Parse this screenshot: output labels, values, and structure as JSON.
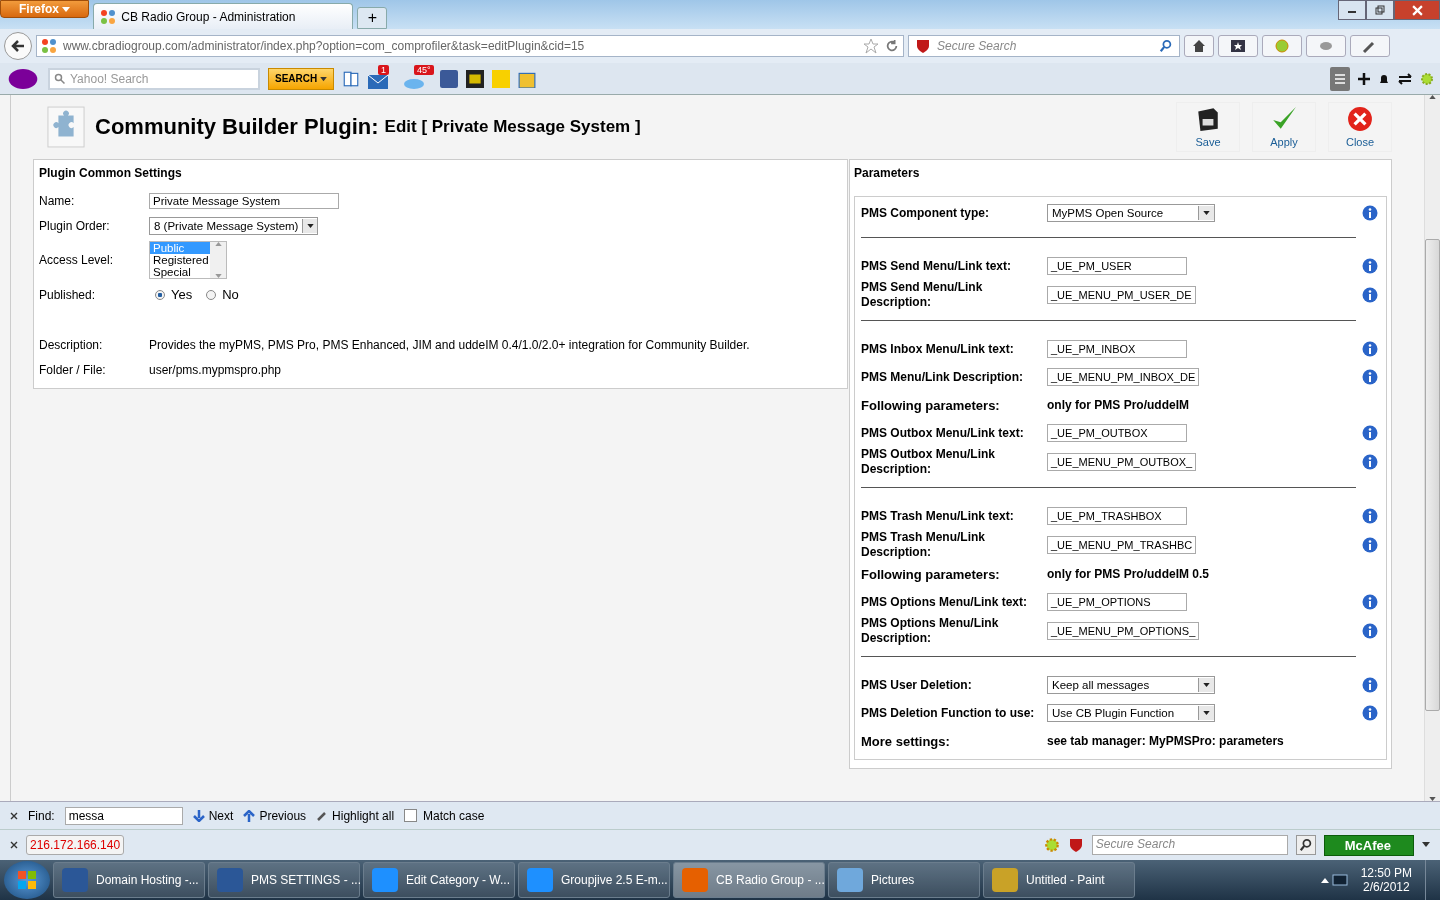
{
  "browser": {
    "menu_button": "Firefox",
    "tabs": [
      {
        "title": "CB Radio Group - Administration",
        "selected": true
      }
    ],
    "new_tab": "+",
    "url": "www.cbradiogroup.com/administrator/index.php?option=com_comprofiler&task=editPlugin&cid=15",
    "search_placeholder": "Secure Search"
  },
  "yahoo_toolbar": {
    "search_placeholder": "Yahoo! Search",
    "search_button": "SEARCH",
    "mail_badge": "1",
    "weather_badge": "45°"
  },
  "page": {
    "title": "Community Builder Plugin:",
    "subtitle": "Edit [ Private Message System ]",
    "actions": [
      {
        "kind": "save",
        "label": "Save"
      },
      {
        "kind": "apply",
        "label": "Apply"
      },
      {
        "kind": "close",
        "label": "Close"
      }
    ]
  },
  "common_settings": {
    "heading": "Plugin Common Settings",
    "name": {
      "label": "Name:",
      "value": "Private Message System"
    },
    "order": {
      "label": "Plugin Order:",
      "value": "8 (Private Message System)"
    },
    "access": {
      "label": "Access Level:",
      "options": [
        {
          "label": "Public",
          "selected": true
        },
        {
          "label": "Registered",
          "selected": false
        },
        {
          "label": "Special",
          "selected": false
        }
      ]
    },
    "published": {
      "label": "Published:",
      "options": [
        {
          "label": "Yes",
          "selected": true
        },
        {
          "label": "No",
          "selected": false
        }
      ]
    },
    "description": {
      "label": "Description:",
      "value": "Provides the myPMS, PMS Pro, PMS Enhanced, JIM and uddeIM 0.4/1.0/2.0+ integration for Community Builder."
    },
    "folder": {
      "label": "Folder / File:",
      "value": "user/pms.mypmspro.php"
    }
  },
  "parameters": {
    "heading": "Parameters",
    "groups": [
      [
        {
          "kind": "select",
          "label": "PMS Component type:",
          "value": "MyPMS Open Source"
        }
      ],
      [
        {
          "kind": "text",
          "label": "PMS Send Menu/Link text:",
          "value": "_UE_PM_USER"
        },
        {
          "kind": "text",
          "label": "PMS Send Menu/Link Description:",
          "value": "_UE_MENU_PM_USER_DE"
        }
      ],
      [
        {
          "kind": "text",
          "label": "PMS Inbox Menu/Link text:",
          "value": "_UE_PM_INBOX"
        },
        {
          "kind": "text",
          "label": "PMS Menu/Link Description:",
          "value": "_UE_MENU_PM_INBOX_DE"
        },
        {
          "kind": "note",
          "label": "Following parameters:",
          "value": "only for PMS Pro/uddeIM"
        },
        {
          "kind": "text",
          "label": "PMS Outbox Menu/Link text:",
          "value": "_UE_PM_OUTBOX"
        },
        {
          "kind": "text",
          "label": "PMS Outbox Menu/Link Description:",
          "value": "_UE_MENU_PM_OUTBOX_"
        }
      ],
      [
        {
          "kind": "text",
          "label": "PMS Trash Menu/Link text:",
          "value": "_UE_PM_TRASHBOX"
        },
        {
          "kind": "text",
          "label": "PMS Trash Menu/Link Description:",
          "value": "_UE_MENU_PM_TRASHBC"
        },
        {
          "kind": "note",
          "label": "Following parameters:",
          "value": "only for PMS Pro/uddeIM 0.5"
        },
        {
          "kind": "text",
          "label": "PMS Options Menu/Link text:",
          "value": "_UE_PM_OPTIONS"
        },
        {
          "kind": "text",
          "label": "PMS Options Menu/Link Description:",
          "value": "_UE_MENU_PM_OPTIONS_"
        }
      ],
      [
        {
          "kind": "select",
          "label": "PMS User Deletion:",
          "value": "Keep all messages"
        },
        {
          "kind": "select",
          "label": "PMS Deletion Function to use:",
          "value": "Use CB Plugin Function"
        },
        {
          "kind": "note",
          "label": "More settings:",
          "value": "see tab manager: MyPMSPro: parameters"
        }
      ]
    ]
  },
  "find_bar": {
    "label": "Find:",
    "value": "messa",
    "next": "Next",
    "previous": "Previous",
    "highlight": "Highlight all",
    "match_case": {
      "label": "Match case",
      "checked": false
    }
  },
  "status_bar": {
    "address": "216.172.166.140",
    "search_placeholder": "Secure Search",
    "security_badge": "McAfee"
  },
  "taskbar": {
    "items": [
      {
        "kind": "word",
        "label": "Domain Hosting -...",
        "selected": false
      },
      {
        "kind": "word",
        "label": "PMS SETTINGS - ...",
        "selected": false
      },
      {
        "kind": "ie",
        "label": "Edit Category - W...",
        "selected": false
      },
      {
        "kind": "ie",
        "label": "Groupjive 2.5 E-m...",
        "selected": false
      },
      {
        "kind": "firefox",
        "label": "CB Radio Group - ...",
        "selected": true
      },
      {
        "kind": "pictures",
        "label": "Pictures",
        "selected": false
      },
      {
        "kind": "paint",
        "label": "Untitled - Paint",
        "selected": false
      }
    ],
    "time": "12:50 PM",
    "date": "2/6/2012"
  }
}
